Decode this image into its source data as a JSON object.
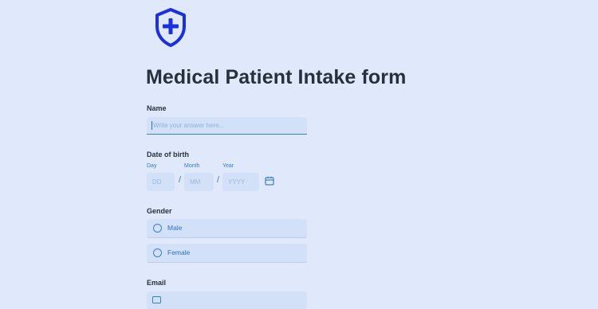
{
  "form": {
    "title": "Medical Patient Intake form",
    "logo_icon": "shield-plus-icon",
    "accent_color": "#1a2fe0"
  },
  "name": {
    "label": "Name",
    "placeholder": "Write your answer here..."
  },
  "dob": {
    "label": "Date of birth",
    "day_label": "Day",
    "month_label": "Month",
    "year_label": "Year",
    "day_placeholder": "DD",
    "month_placeholder": "MM",
    "year_placeholder": "YYYY",
    "separator": "/",
    "calendar_icon": "calendar-icon"
  },
  "gender": {
    "label": "Gender",
    "options": [
      {
        "label": "Male"
      },
      {
        "label": "Female"
      }
    ]
  },
  "email": {
    "label": "Email",
    "icon": "envelope-icon"
  }
}
